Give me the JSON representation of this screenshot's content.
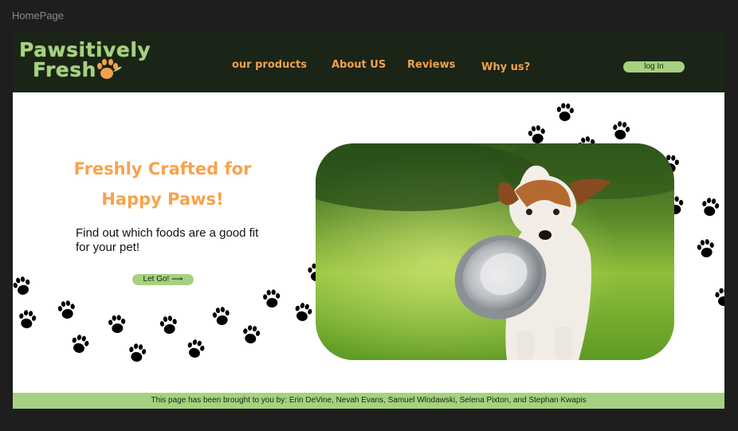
{
  "frame_label": "HomePage",
  "brand": {
    "line1": "Pawsitively",
    "line2": "Fresh",
    "logo_icon": "paw-icon"
  },
  "nav": {
    "products": "our products",
    "about": "About US",
    "reviews": "Reviews",
    "why": "Why us?",
    "login": "log In"
  },
  "hero": {
    "title_line1": "Freshly Crafted for",
    "title_line2": "Happy Paws!",
    "subtitle": "Find out which foods are a good fit for your pet!",
    "cta": "Let Go! ⟶",
    "image": "dog-with-bowl-photo"
  },
  "footer": {
    "credits": "This page has been brought to you by: Erin DeVine, Nevah Evans, Samuel Wlodawski, Selena Pixton, and Stephan Kwapis"
  },
  "colors": {
    "header_bg": "#1a2417",
    "accent_green": "#a6d27f",
    "accent_orange": "#f2a24a",
    "paw": "#000000"
  }
}
